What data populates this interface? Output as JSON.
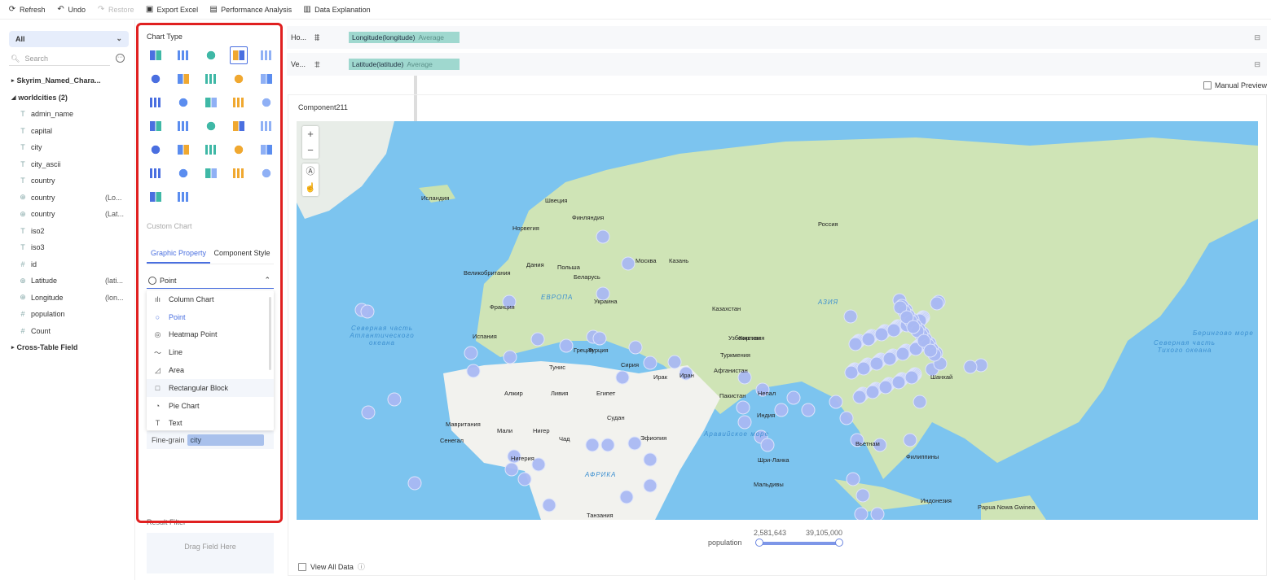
{
  "toolbar": {
    "refresh": "Refresh",
    "undo": "Undo",
    "restore": "Restore",
    "export": "Export Excel",
    "performance": "Performance Analysis",
    "explanation": "Data Explanation"
  },
  "left": {
    "scope": "All",
    "search_placeholder": "Search",
    "tree": [
      {
        "type": "group",
        "label": "Skyrim_Named_Chara...",
        "expanded": false
      },
      {
        "type": "group",
        "label": "worldcities (2)",
        "expanded": true
      },
      {
        "type": "field",
        "icon": "text",
        "label": "admin_name"
      },
      {
        "type": "field",
        "icon": "text",
        "label": "capital"
      },
      {
        "type": "field",
        "icon": "text",
        "label": "city"
      },
      {
        "type": "field",
        "icon": "text",
        "label": "city_ascii"
      },
      {
        "type": "field",
        "icon": "text",
        "label": "country"
      },
      {
        "type": "field",
        "icon": "globe",
        "label": "country",
        "extra": "(Lo..."
      },
      {
        "type": "field",
        "icon": "globe",
        "label": "country",
        "extra": "(Lat..."
      },
      {
        "type": "field",
        "icon": "text",
        "label": "iso2"
      },
      {
        "type": "field",
        "icon": "text",
        "label": "iso3"
      },
      {
        "type": "field",
        "icon": "number",
        "label": "id"
      },
      {
        "type": "field",
        "icon": "globe",
        "label": "Latitude",
        "extra": "(lati..."
      },
      {
        "type": "field",
        "icon": "globe",
        "label": "Longitude",
        "extra": "(lon..."
      },
      {
        "type": "field",
        "icon": "number",
        "label": "population"
      },
      {
        "type": "field",
        "icon": "number",
        "label": "Count"
      },
      {
        "type": "group",
        "label": "Cross-Table Field",
        "expanded": false
      }
    ]
  },
  "config": {
    "chart_type_title": "Chart Type",
    "chart_types_count": 32,
    "selected_chart_type_index": 3,
    "custom_chart": "Custom Chart",
    "tabs": [
      "Graphic Property",
      "Component Style"
    ],
    "active_tab": 0,
    "mark_type": "Point",
    "mark_options": [
      {
        "label": "Column Chart",
        "icon": "column-chart"
      },
      {
        "label": "Point",
        "icon": "circle",
        "selected": true
      },
      {
        "label": "Heatmap Point",
        "icon": "heatmap"
      },
      {
        "label": "Line",
        "icon": "line"
      },
      {
        "label": "Area",
        "icon": "area"
      },
      {
        "label": "Rectangular Block",
        "icon": "square",
        "hover": true
      },
      {
        "label": "Pie Chart",
        "icon": "pie"
      },
      {
        "label": "Text",
        "icon": "text"
      }
    ],
    "fine_grain_label": "Fine-grain",
    "fine_grain_field": "city",
    "result_filter": "Result Filter",
    "drag_hint": "Drag Field Here"
  },
  "shelves": {
    "horizontal": {
      "label": "Ho...",
      "field": "Longitude(longitude)",
      "agg": "Average"
    },
    "vertical": {
      "label": "Ve...",
      "field": "Latitude(latitude)",
      "agg": "Average"
    }
  },
  "manual_preview": "Manual Preview",
  "component": {
    "title": "Component211",
    "map_labels": [
      "Исландия",
      "Швеция",
      "Финляндия",
      "Норвегия",
      "Россия",
      "Москва",
      "Казань",
      "Великобритания",
      "Дания",
      "Польша",
      "Беларусь",
      "Украина",
      "Франция",
      "Казахстан",
      "Испания",
      "Турция",
      "Узбекистан",
      "Греция",
      "Киргизия",
      "Туркмения",
      "Тунис",
      "Сирия",
      "Ирак",
      "Иран",
      "Афганистан",
      "Алжир",
      "Ливия",
      "Египет",
      "Пакистан",
      "Непал",
      "Индия",
      "Мавритания",
      "Мали",
      "Нигер",
      "Чад",
      "Судан",
      "Эфиопия",
      "Нигерия",
      "Сенегал",
      "Танзания",
      "Вьетнам",
      "Филиппины",
      "Шри-Ланка",
      "Мальдивы",
      "Индонезия",
      "Papua Nowa Gwinea",
      "Шанхай",
      "ЕВРОПА",
      "АЗИЯ",
      "АФРИКА",
      "Берингово море",
      "Северная часть Атлантического океана",
      "Северная часть Тихого океана",
      "Аравийское море"
    ],
    "legend": {
      "field": "population",
      "min": "2,581,643",
      "max": "39,105,000"
    },
    "view_all": "View All Data",
    "colors": {
      "point": "#a9b8f2",
      "ocean": "#7cc4ef",
      "land": "#c9e2b0",
      "accent": "#4a6fe0"
    }
  }
}
